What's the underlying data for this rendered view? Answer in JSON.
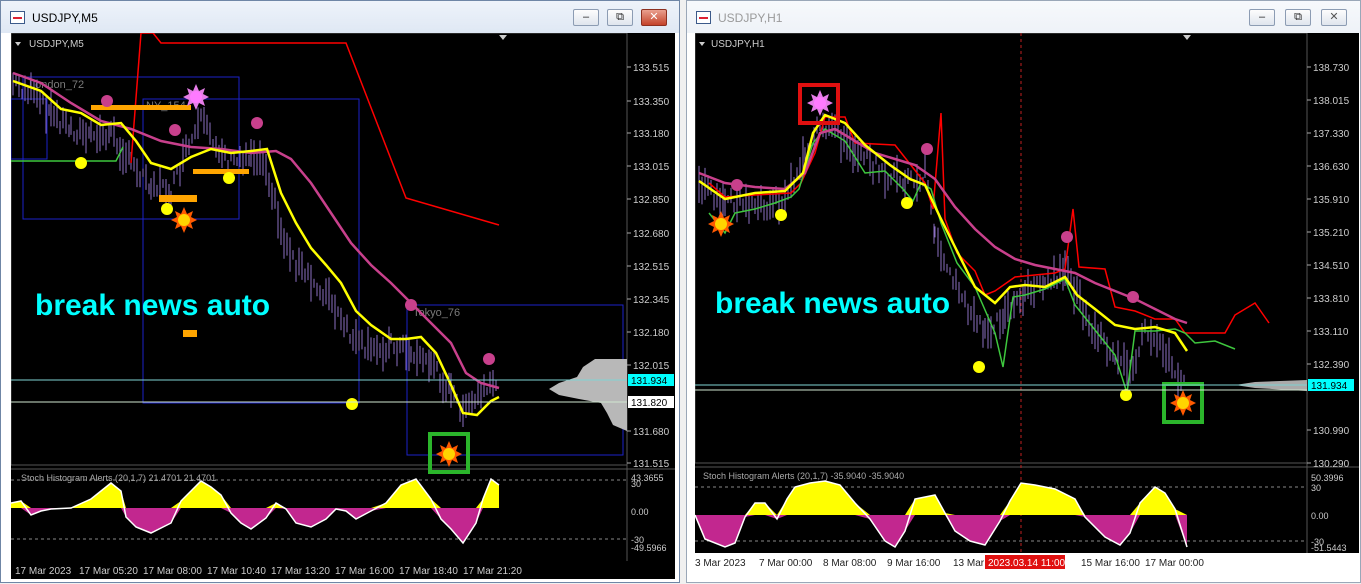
{
  "windows": [
    {
      "title": "USDJPY,M5",
      "label": "USDJPY,M5",
      "watermark": "break news auto",
      "sessions": [
        "London_72",
        "NY_154",
        "Tokyo_76"
      ],
      "price_ticks": [
        "133.515",
        "133.350",
        "133.180",
        "133.015",
        "132.850",
        "132.680",
        "132.515",
        "132.345",
        "132.180",
        "132.015",
        "131.680",
        "131.515"
      ],
      "bid_price": "131.934",
      "ask_price": "131.820",
      "hidden_price": "131.8??",
      "indicator_label": "Stoch Histogram Alerts (20,1,7) 21.4701 21.4701",
      "indicator_ticks": [
        "43.3655",
        "30",
        "0.00",
        "-30",
        "-49.5966"
      ],
      "time_ticks": [
        "17 Mar 2023",
        "17 Mar 05:20",
        "17 Mar 08:00",
        "17 Mar 10:40",
        "17 Mar 13:20",
        "17 Mar 16:00",
        "17 Mar 18:40",
        "17 Mar 21:20"
      ]
    },
    {
      "title": "USDJPY,H1",
      "label": "USDJPY,H1",
      "watermark": "break news auto",
      "price_ticks": [
        "138.730",
        "138.015",
        "137.330",
        "136.630",
        "135.910",
        "135.210",
        "134.510",
        "133.810",
        "133.110",
        "132.390",
        "130.990",
        "130.290"
      ],
      "bid_price": "131.934",
      "ask_price": "131.820",
      "indicator_label": "Stoch Histogram Alerts (20,1,7) -35.9040 -35.9040",
      "indicator_ticks": [
        "50.3996",
        "30",
        "0.00",
        "-30",
        "-51.5443"
      ],
      "time_ticks": [
        "3 Mar 2023",
        "7 Mar 00:00",
        "8 Mar 08:00",
        "9 Mar 16:00",
        "13 Mar",
        "15 Mar 16:00",
        "17 Mar 00:00"
      ],
      "crosshair_time": "2023.03.14 11:00"
    }
  ],
  "colors": {
    "chart_bg": "#000000",
    "candles": "#8b6fc2",
    "yellow_line": "#ffff00",
    "magenta_line": "#c8408c",
    "red_line": "#ff0000",
    "green_line": "#3ec73e",
    "watermark": "#00ffff",
    "session_box": "#1c22c8",
    "orange": "#ffa500",
    "hist_pos": "#ffff00",
    "hist_neg": "#c2278f"
  }
}
